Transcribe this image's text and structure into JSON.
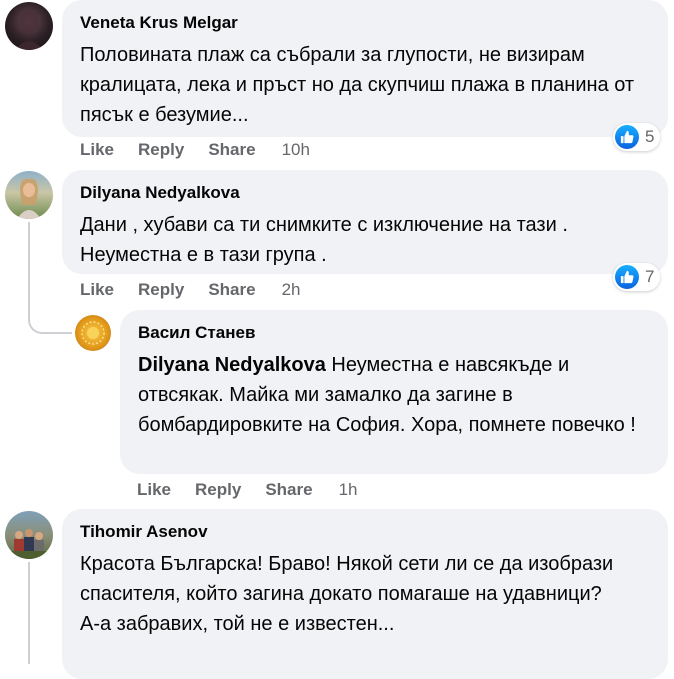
{
  "comments": [
    {
      "author": "Veneta Krus Melgar",
      "text": "Половината плаж са събрали за глупости, не визирам кралицата, лека и пръст но да скупчиш плажа в планина от пясък е безумие...",
      "reactions": "5",
      "actions": {
        "like": "Like",
        "reply": "Reply",
        "share": "Share",
        "time": "10h"
      }
    },
    {
      "author": "Dilyana Nedyalkova",
      "text": "Дани , хубави са ти снимките с изключение на тази . Неуместна е в тази група .",
      "reactions": "7",
      "actions": {
        "like": "Like",
        "reply": "Reply",
        "share": "Share",
        "time": "2h"
      }
    },
    {
      "author": "Васил Станев",
      "mention": "Dilyana Nedyalkova",
      "text": " Неуместна е навсякъде и отвсякак. Майка ми замалко да загине в бомбардировките на София. Хора, помнете повечко !",
      "actions": {
        "like": "Like",
        "reply": "Reply",
        "share": "Share",
        "time": "1h"
      }
    },
    {
      "author": "Tihomir Asenov",
      "text_line1": "Красота Българска! Браво! Някой сети ли се да изобрази спасителя, който загина докато помагаше на удавници?",
      "text_line2": "А-а забравих, той не е известен..."
    }
  ],
  "colors": {
    "bubble": "#f0f2f5",
    "meta": "#65676b",
    "like_blue": "#1877f2"
  },
  "icons": [
    "like-reaction-icon",
    "avatar"
  ]
}
